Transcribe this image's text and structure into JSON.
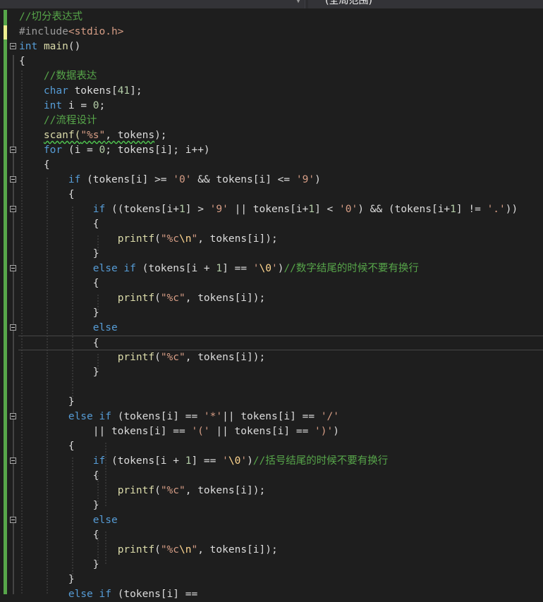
{
  "toolbar": {
    "scope_label": "(全局范围)"
  },
  "lines": [
    {
      "fold": false,
      "parts": [
        {
          "t": "//切分表达式",
          "c": "cm"
        }
      ]
    },
    {
      "fold": false,
      "parts": [
        {
          "t": "#include",
          "c": "pp"
        },
        {
          "t": "<stdio.h>",
          "c": "str"
        }
      ]
    },
    {
      "fold": true,
      "parts": [
        {
          "t": "int",
          "c": "kw"
        },
        {
          "t": " ",
          "c": "id"
        },
        {
          "t": "main",
          "c": "fn"
        },
        {
          "t": "()",
          "c": "id"
        }
      ]
    },
    {
      "fold": false,
      "parts": [
        {
          "t": "{",
          "c": "id"
        }
      ]
    },
    {
      "fold": false,
      "parts": [
        {
          "t": "    ",
          "c": "id"
        },
        {
          "t": "//数据表达",
          "c": "cm"
        }
      ]
    },
    {
      "fold": false,
      "parts": [
        {
          "t": "    ",
          "c": "id"
        },
        {
          "t": "char",
          "c": "kw"
        },
        {
          "t": " tokens[",
          "c": "id"
        },
        {
          "t": "41",
          "c": "num"
        },
        {
          "t": "];",
          "c": "id"
        }
      ]
    },
    {
      "fold": false,
      "parts": [
        {
          "t": "    ",
          "c": "id"
        },
        {
          "t": "int",
          "c": "kw"
        },
        {
          "t": " i = ",
          "c": "id"
        },
        {
          "t": "0",
          "c": "num"
        },
        {
          "t": ";",
          "c": "id"
        }
      ]
    },
    {
      "fold": false,
      "parts": [
        {
          "t": "    ",
          "c": "id"
        },
        {
          "t": "//流程设计",
          "c": "cm"
        }
      ]
    },
    {
      "fold": false,
      "parts": [
        {
          "t": "    ",
          "c": "id"
        },
        {
          "t": "scanf(",
          "c": "fn squiggle"
        },
        {
          "t": "\"%s\"",
          "c": "str squiggle"
        },
        {
          "t": ", tokens",
          "c": "id squiggle"
        },
        {
          "t": ");",
          "c": "id"
        }
      ]
    },
    {
      "fold": true,
      "parts": [
        {
          "t": "    ",
          "c": "id"
        },
        {
          "t": "for",
          "c": "kw"
        },
        {
          "t": " (i = ",
          "c": "id"
        },
        {
          "t": "0",
          "c": "num"
        },
        {
          "t": "; tokens[i]; i++)",
          "c": "id"
        }
      ]
    },
    {
      "fold": false,
      "parts": [
        {
          "t": "    {",
          "c": "id"
        }
      ]
    },
    {
      "fold": true,
      "parts": [
        {
          "t": "        ",
          "c": "id"
        },
        {
          "t": "if",
          "c": "kw"
        },
        {
          "t": " (tokens[i] >= ",
          "c": "id"
        },
        {
          "t": "'0'",
          "c": "str"
        },
        {
          "t": " && tokens[i] <= ",
          "c": "id"
        },
        {
          "t": "'9'",
          "c": "str"
        },
        {
          "t": ")",
          "c": "id"
        }
      ]
    },
    {
      "fold": false,
      "parts": [
        {
          "t": "        {",
          "c": "id"
        }
      ]
    },
    {
      "fold": true,
      "parts": [
        {
          "t": "            ",
          "c": "id"
        },
        {
          "t": "if",
          "c": "kw"
        },
        {
          "t": " ((tokens[i+",
          "c": "id"
        },
        {
          "t": "1",
          "c": "num"
        },
        {
          "t": "] > ",
          "c": "id"
        },
        {
          "t": "'9'",
          "c": "str"
        },
        {
          "t": " || tokens[i+",
          "c": "id"
        },
        {
          "t": "1",
          "c": "num"
        },
        {
          "t": "] < ",
          "c": "id"
        },
        {
          "t": "'0'",
          "c": "str"
        },
        {
          "t": ") && (tokens[i+",
          "c": "id"
        },
        {
          "t": "1",
          "c": "num"
        },
        {
          "t": "] != ",
          "c": "id"
        },
        {
          "t": "'.'",
          "c": "str"
        },
        {
          "t": "))",
          "c": "id"
        }
      ]
    },
    {
      "fold": false,
      "parts": [
        {
          "t": "            {",
          "c": "id"
        }
      ]
    },
    {
      "fold": false,
      "parts": [
        {
          "t": "                ",
          "c": "id"
        },
        {
          "t": "printf",
          "c": "fn"
        },
        {
          "t": "(",
          "c": "id"
        },
        {
          "t": "\"%c",
          "c": "str"
        },
        {
          "t": "\\n",
          "c": "esc"
        },
        {
          "t": "\"",
          "c": "str"
        },
        {
          "t": ", tokens[i]);",
          "c": "id"
        }
      ]
    },
    {
      "fold": false,
      "parts": [
        {
          "t": "            }",
          "c": "id"
        }
      ]
    },
    {
      "fold": true,
      "parts": [
        {
          "t": "            ",
          "c": "id"
        },
        {
          "t": "else",
          "c": "kw"
        },
        {
          "t": " ",
          "c": "id"
        },
        {
          "t": "if",
          "c": "kw"
        },
        {
          "t": " (tokens[i + ",
          "c": "id"
        },
        {
          "t": "1",
          "c": "num"
        },
        {
          "t": "] == ",
          "c": "id"
        },
        {
          "t": "'",
          "c": "str"
        },
        {
          "t": "\\0",
          "c": "esc"
        },
        {
          "t": "'",
          "c": "str"
        },
        {
          "t": ")",
          "c": "id"
        },
        {
          "t": "//数字结尾的时候不要有换行",
          "c": "cm"
        }
      ]
    },
    {
      "fold": false,
      "parts": [
        {
          "t": "            {",
          "c": "id"
        }
      ]
    },
    {
      "fold": false,
      "parts": [
        {
          "t": "                ",
          "c": "id"
        },
        {
          "t": "printf",
          "c": "fn"
        },
        {
          "t": "(",
          "c": "id"
        },
        {
          "t": "\"%c\"",
          "c": "str"
        },
        {
          "t": ", tokens[i]);",
          "c": "id"
        }
      ]
    },
    {
      "fold": false,
      "parts": [
        {
          "t": "            }",
          "c": "id"
        }
      ]
    },
    {
      "fold": true,
      "parts": [
        {
          "t": "            ",
          "c": "id"
        },
        {
          "t": "else",
          "c": "kw"
        }
      ]
    },
    {
      "fold": false,
      "current": true,
      "parts": [
        {
          "t": "            {",
          "c": "id"
        }
      ]
    },
    {
      "fold": false,
      "parts": [
        {
          "t": "                ",
          "c": "id"
        },
        {
          "t": "printf",
          "c": "fn"
        },
        {
          "t": "(",
          "c": "id"
        },
        {
          "t": "\"%c\"",
          "c": "str"
        },
        {
          "t": ", tokens[i]);",
          "c": "id"
        }
      ]
    },
    {
      "fold": false,
      "parts": [
        {
          "t": "            }",
          "c": "id"
        }
      ]
    },
    {
      "fold": false,
      "parts": [
        {
          "t": "",
          "c": "id"
        }
      ]
    },
    {
      "fold": false,
      "parts": [
        {
          "t": "        }",
          "c": "id"
        }
      ]
    },
    {
      "fold": true,
      "parts": [
        {
          "t": "        ",
          "c": "id"
        },
        {
          "t": "else",
          "c": "kw"
        },
        {
          "t": " ",
          "c": "id"
        },
        {
          "t": "if",
          "c": "kw"
        },
        {
          "t": " (tokens[i] == ",
          "c": "id"
        },
        {
          "t": "'*'",
          "c": "str"
        },
        {
          "t": "|| tokens[i] == ",
          "c": "id"
        },
        {
          "t": "'/'",
          "c": "str"
        }
      ]
    },
    {
      "fold": false,
      "parts": [
        {
          "t": "            || tokens[i] == ",
          "c": "id"
        },
        {
          "t": "'('",
          "c": "str"
        },
        {
          "t": " || tokens[i] == ",
          "c": "id"
        },
        {
          "t": "')'",
          "c": "str"
        },
        {
          "t": ")",
          "c": "id"
        }
      ]
    },
    {
      "fold": false,
      "parts": [
        {
          "t": "        {",
          "c": "id"
        }
      ]
    },
    {
      "fold": true,
      "parts": [
        {
          "t": "            ",
          "c": "id"
        },
        {
          "t": "if",
          "c": "kw"
        },
        {
          "t": " (tokens[i + ",
          "c": "id"
        },
        {
          "t": "1",
          "c": "num"
        },
        {
          "t": "] == ",
          "c": "id"
        },
        {
          "t": "'",
          "c": "str"
        },
        {
          "t": "\\0",
          "c": "esc"
        },
        {
          "t": "'",
          "c": "str"
        },
        {
          "t": ")",
          "c": "id"
        },
        {
          "t": "//括号结尾的时候不要有换行",
          "c": "cm"
        }
      ]
    },
    {
      "fold": false,
      "parts": [
        {
          "t": "            {",
          "c": "id"
        }
      ]
    },
    {
      "fold": false,
      "parts": [
        {
          "t": "                ",
          "c": "id"
        },
        {
          "t": "printf",
          "c": "fn"
        },
        {
          "t": "(",
          "c": "id"
        },
        {
          "t": "\"%c\"",
          "c": "str"
        },
        {
          "t": ", tokens[i]);",
          "c": "id"
        }
      ]
    },
    {
      "fold": false,
      "parts": [
        {
          "t": "            }",
          "c": "id"
        }
      ]
    },
    {
      "fold": true,
      "parts": [
        {
          "t": "            ",
          "c": "id"
        },
        {
          "t": "else",
          "c": "kw"
        }
      ]
    },
    {
      "fold": false,
      "parts": [
        {
          "t": "            {",
          "c": "id"
        }
      ]
    },
    {
      "fold": false,
      "parts": [
        {
          "t": "                ",
          "c": "id"
        },
        {
          "t": "printf",
          "c": "fn"
        },
        {
          "t": "(",
          "c": "id"
        },
        {
          "t": "\"%c",
          "c": "str"
        },
        {
          "t": "\\n",
          "c": "esc"
        },
        {
          "t": "\"",
          "c": "str"
        },
        {
          "t": ", tokens[i]);",
          "c": "id"
        }
      ]
    },
    {
      "fold": false,
      "parts": [
        {
          "t": "            }",
          "c": "id"
        }
      ]
    },
    {
      "fold": false,
      "parts": [
        {
          "t": "        }",
          "c": "id"
        }
      ]
    },
    {
      "fold": false,
      "parts": [
        {
          "t": "        ",
          "c": "id"
        },
        {
          "t": "else",
          "c": "kw"
        },
        {
          "t": " ",
          "c": "id"
        },
        {
          "t": "if",
          "c": "kw"
        },
        {
          "t": " (tokens[i] == ",
          "c": "id"
        }
      ]
    }
  ]
}
